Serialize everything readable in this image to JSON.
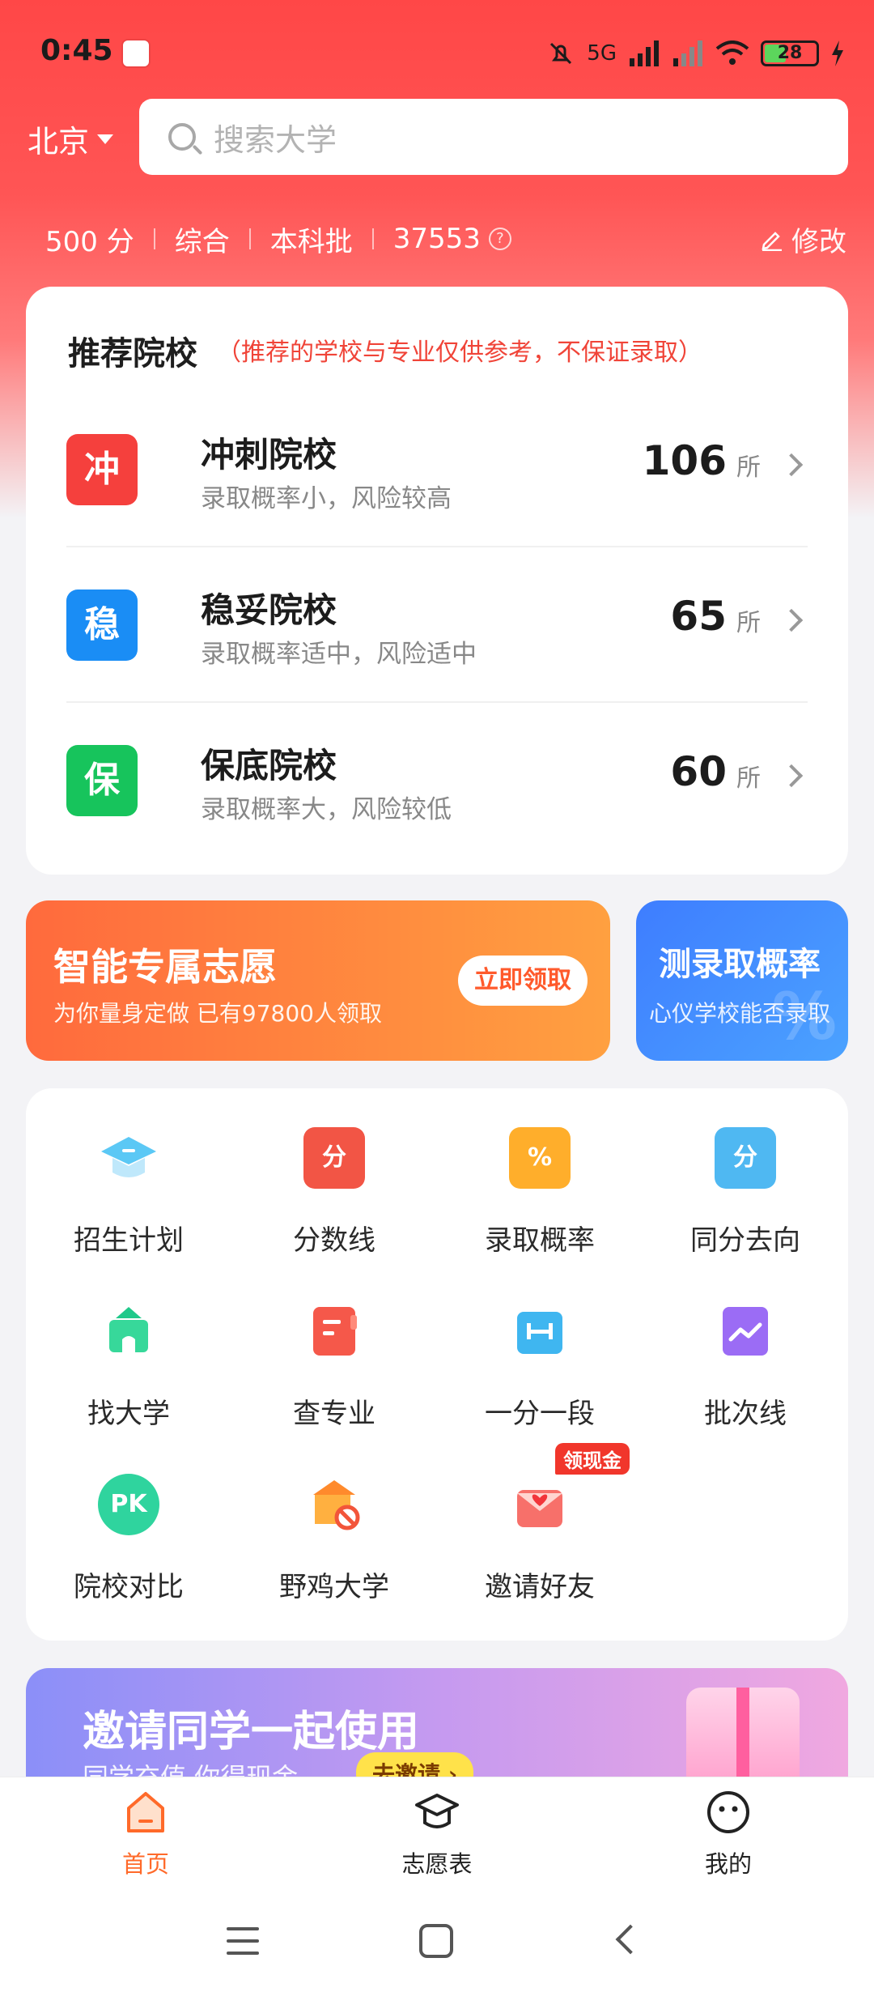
{
  "status_bar": {
    "time": "0:45",
    "network": "5G",
    "battery": "28"
  },
  "header": {
    "city": "北京",
    "search_placeholder": "搜索大学"
  },
  "score_row": {
    "score": "500 分",
    "subject": "综合",
    "batch": "本科批",
    "rank": "37553",
    "edit_label": "修改"
  },
  "recommend": {
    "title": "推荐院校",
    "note": "（推荐的学校与专业仅供参考，不保证录取）",
    "rows": [
      {
        "badge": "冲",
        "name": "冲刺院校",
        "desc": "录取概率小，风险较高",
        "count": "106",
        "unit": "所"
      },
      {
        "badge": "稳",
        "name": "稳妥院校",
        "desc": "录取概率适中，风险适中",
        "count": "65",
        "unit": "所"
      },
      {
        "badge": "保",
        "name": "保底院校",
        "desc": "录取概率大，风险较低",
        "count": "60",
        "unit": "所"
      }
    ]
  },
  "promo": {
    "left_title": "智能专属志愿",
    "left_sub": "为你量身定做  已有97800人领取",
    "left_button": "立即领取",
    "right_title": "测录取概率",
    "right_sub": "心仪学校能否录取"
  },
  "tools": [
    {
      "label": "招生计划",
      "icon": "graduation-cap-icon"
    },
    {
      "label": "分数线",
      "icon": "score-card-icon",
      "glyph": "分"
    },
    {
      "label": "录取概率",
      "icon": "percent-basket-icon",
      "glyph": "%"
    },
    {
      "label": "同分去向",
      "icon": "score-bag-icon",
      "glyph": "分"
    },
    {
      "label": "找大学",
      "icon": "school-building-icon"
    },
    {
      "label": "查专业",
      "icon": "major-book-icon"
    },
    {
      "label": "一分一段",
      "icon": "ruler-bag-icon"
    },
    {
      "label": "批次线",
      "icon": "trend-chart-icon"
    },
    {
      "label": "院校对比",
      "icon": "pk-heart-icon",
      "glyph": "PK"
    },
    {
      "label": "野鸡大学",
      "icon": "fake-school-icon"
    },
    {
      "label": "邀请好友",
      "icon": "invite-envelope-icon",
      "tag": "领现金"
    }
  ],
  "invite_banner": {
    "title": "邀请同学一起使用",
    "subtitle": "同学充值 你得现金",
    "button": "去邀请 ›"
  },
  "bottom_nav": [
    {
      "label": "首页",
      "icon": "home-icon",
      "active": true
    },
    {
      "label": "志愿表",
      "icon": "graduation-cap-icon",
      "active": false
    },
    {
      "label": "我的",
      "icon": "smiley-icon",
      "active": false
    }
  ],
  "colors": {
    "brand_red": "#ff4747",
    "accent_orange": "#ff6a2a",
    "blue": "#1a8df5",
    "green": "#17c45c"
  }
}
